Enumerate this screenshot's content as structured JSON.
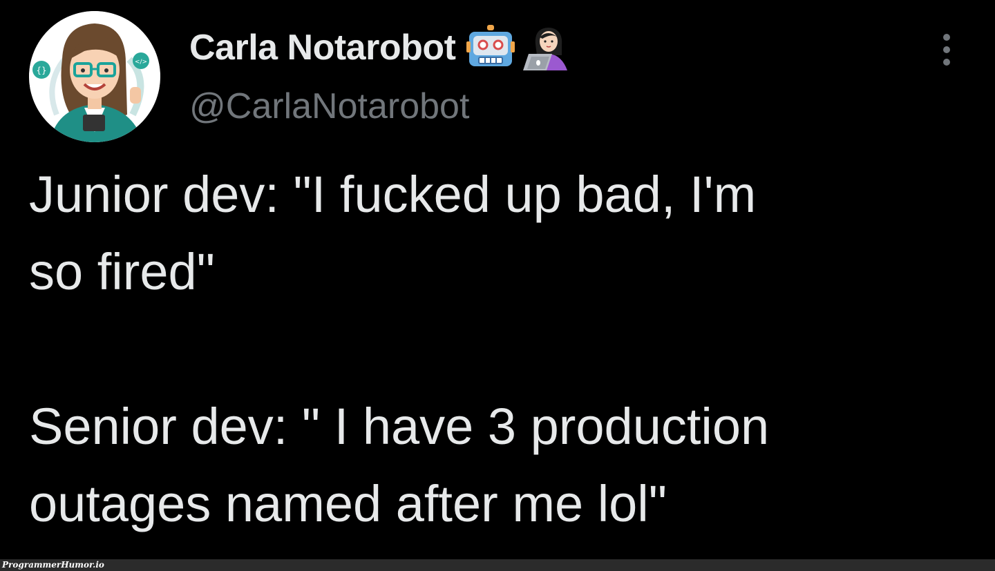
{
  "tweet": {
    "author": {
      "display_name": "Carla Notarobot",
      "handle": "@CarlaNotarobot",
      "avatar_icon": "cartoon-woman-avatar",
      "name_emojis": [
        "robot-emoji",
        "woman-technologist-emoji"
      ]
    },
    "more_icon": "more-vertical-icon",
    "text_paragraphs": [
      "Junior dev: \"I fucked up bad, I'm\nso fired\"",
      "Senior dev: \" I have 3 production\noutages named after me lol\""
    ]
  },
  "watermark": {
    "text": "ProgrammerHumor.io"
  },
  "colors": {
    "background": "#000000",
    "primary_text": "#e7e9ea",
    "secondary_text": "#71767b",
    "watermark_bar": "#2b2b2b"
  }
}
